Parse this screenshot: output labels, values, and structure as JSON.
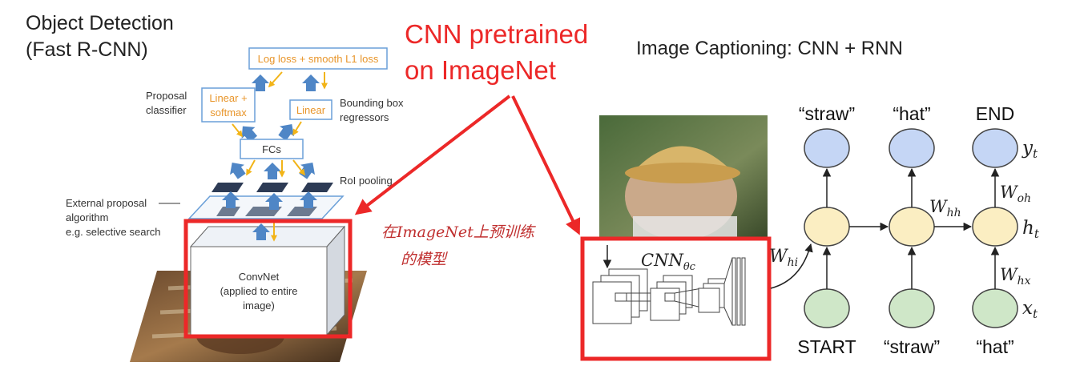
{
  "left_panel": {
    "title_line1": "Object Detection",
    "title_line2": "(Fast R-CNN)",
    "loss_box": "Log loss + smooth L1 loss",
    "proposal_classifier_line1": "Proposal",
    "proposal_classifier_line2": "classifier",
    "linear_softmax_line1": "Linear +",
    "linear_softmax_line2": "softmax",
    "linear": "Linear",
    "bbox_regressors_line1": "Bounding box",
    "bbox_regressors_line2": "regressors",
    "fcs": "FCs",
    "roi_pooling": "RoI pooling",
    "external_proposal_line1": "External proposal",
    "external_proposal_line2": "algorithm",
    "external_proposal_line3": "e.g. selective search",
    "convnet_line1": "ConvNet",
    "convnet_line2": "(applied to entire",
    "convnet_line3": "image)"
  },
  "center_callout": {
    "line1": "CNN pretrained",
    "line2": "on ImageNet",
    "handwritten_line1": "在ImageNet上预训练",
    "handwritten_line2": "的模型"
  },
  "right_panel": {
    "title": "Image Captioning: CNN + RNN",
    "cnn_label": "CNN",
    "cnn_subscript": "θc",
    "w_hi": "W",
    "w_hi_sub": "hi",
    "w_hh": "W",
    "w_hh_sub": "hh",
    "w_oh": "W",
    "w_oh_sub": "oh",
    "w_hx": "W",
    "w_hx_sub": "hx",
    "y_t": "y",
    "y_t_sub": "t",
    "h_t": "h",
    "h_t_sub": "t",
    "x_t": "x",
    "x_t_sub": "t",
    "outputs": [
      "“straw”",
      "“hat”",
      "END"
    ],
    "inputs": [
      "START",
      "“straw”",
      "“hat”"
    ]
  },
  "colors": {
    "accent_red": "#ec2828",
    "arrow_blue": "#4f86c6",
    "arrow_yellow": "#f2b418",
    "box_border": "#6a9fd8",
    "orange_text": "#e8952a",
    "node_blue": "#c5d6f5",
    "node_yellow": "#fbeec2",
    "node_green": "#cfe7c8"
  }
}
